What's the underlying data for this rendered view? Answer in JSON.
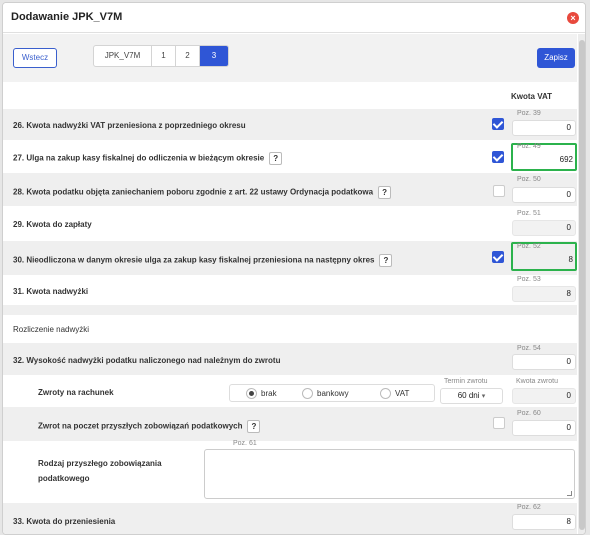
{
  "dialog": {
    "title": "Dodawanie JPK_V7M"
  },
  "toolbar": {
    "back_label": "Wstecz",
    "tabs": [
      "JPK_V7M",
      "1",
      "2",
      "3"
    ],
    "active_tab": "3",
    "save_label": "Zapisz"
  },
  "column_header": "Kwota VAT",
  "rows": [
    {
      "label": "26. Kwota nadwyżki VAT przeniesiona z poprzedniego okresu",
      "help": false,
      "checkbox": true,
      "poz": "Poz. 39",
      "value": "0",
      "highlighted": false
    },
    {
      "label": "27. Ulga na zakup kasy fiskalnej do odliczenia w bieżącym okresie",
      "help": true,
      "checkbox": true,
      "poz": "Poz. 49",
      "value": "692",
      "highlighted": true
    },
    {
      "label": "28. Kwota podatku objęta zaniechaniem poboru zgodnie z art. 22 ustawy Ordynacja podatkowa",
      "help": true,
      "checkbox": false,
      "poz": "Poz. 50",
      "value": "0",
      "highlighted": false
    },
    {
      "label": "29. Kwota do zapłaty",
      "help": false,
      "checkbox": null,
      "poz": "Poz. 51",
      "value": "0",
      "highlighted": false
    },
    {
      "label": "30. Nieodliczona w danym okresie ulga za zakup kasy fiskalnej przeniesiona na następny okres",
      "help": true,
      "checkbox": true,
      "poz": "Poz. 52",
      "value": "8",
      "highlighted": true
    },
    {
      "label": "31. Kwota nadwyżki",
      "help": false,
      "checkbox": null,
      "poz": "Poz. 53",
      "value": "8",
      "highlighted": false
    }
  ],
  "surplus": {
    "section_title": "Rozliczenie nadwyżki",
    "row32": {
      "label": "32. Wysokość nadwyżki podatku naliczonego nad należnym do zwrotu",
      "poz": "Poz. 54",
      "value": "0"
    },
    "refund": {
      "label": "Zwroty na rachunek",
      "options": [
        "brak",
        "bankowy",
        "VAT"
      ],
      "selected": "brak",
      "term_label": "Termin zwrotu",
      "term_value": "60 dni",
      "amount_label": "Kwota zwrotu",
      "amount_value": "0"
    },
    "future": {
      "label": "Zwrot na poczet przyszłych zobowiązań podatkowych",
      "checkbox": false,
      "poz": "Poz. 60",
      "value": "0"
    },
    "kind": {
      "label_line1": "Rodzaj przyszłego zobowiązania",
      "label_line2": "podatkowego",
      "poz": "Poz. 61",
      "value": ""
    },
    "row33": {
      "label": "33. Kwota do przeniesienia",
      "poz": "Poz. 62",
      "value": "8"
    }
  },
  "colors": {
    "accent": "#2f56d6",
    "highlight": "#2bb24c",
    "close": "#e8493d"
  }
}
